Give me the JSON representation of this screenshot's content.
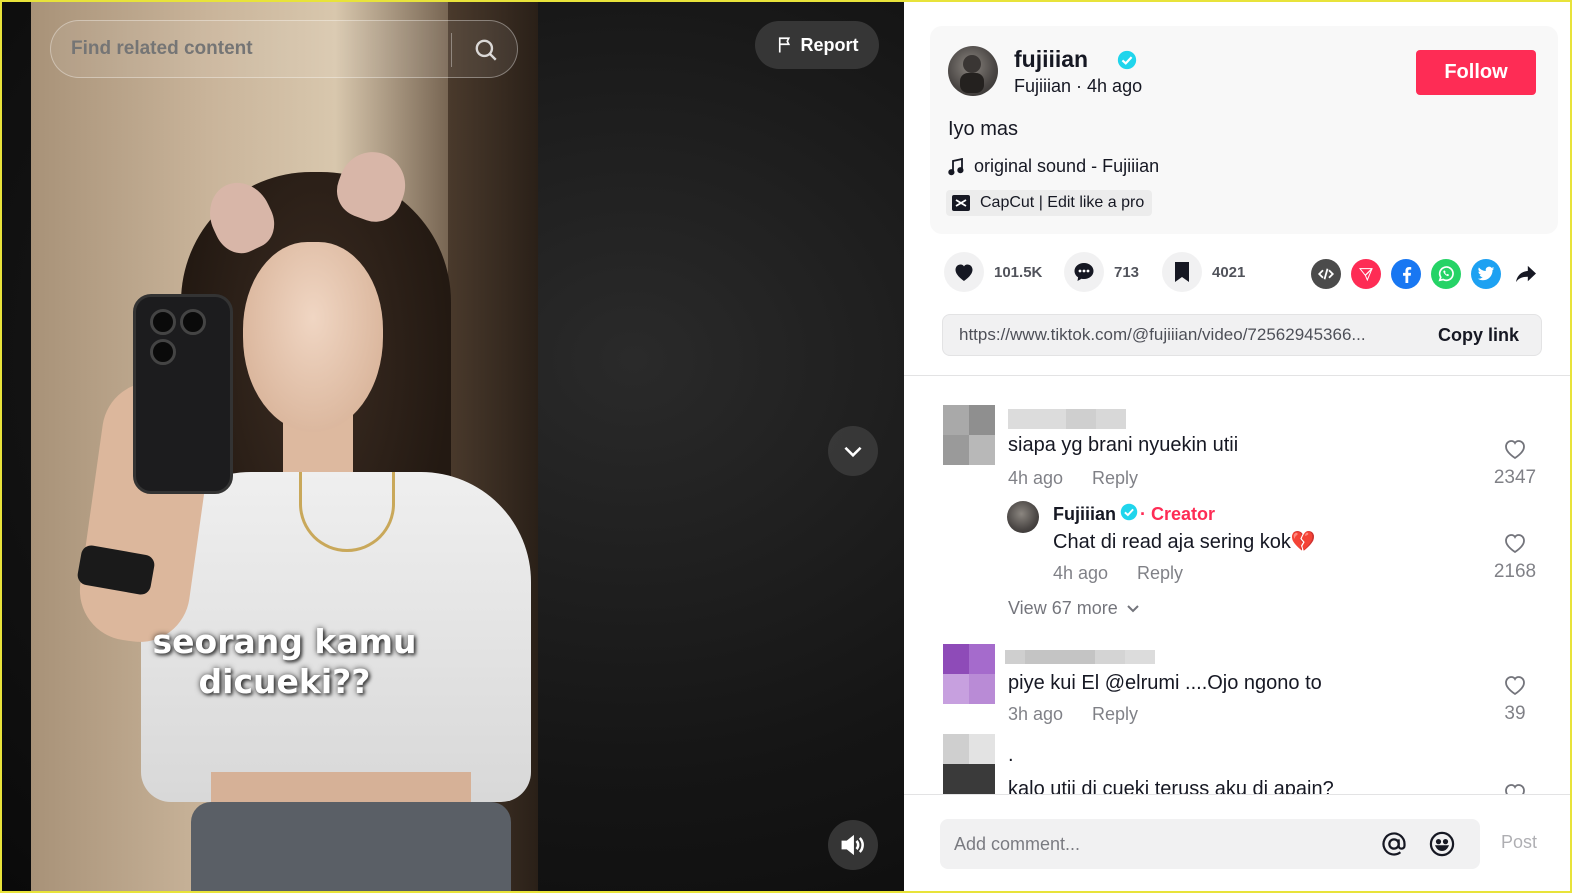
{
  "search": {
    "placeholder": "Find related content"
  },
  "video": {
    "caption": "seorang kamu\ndicueki??",
    "report_label": "Report"
  },
  "author": {
    "username": "fujiiian",
    "nickname": "Fujiiian",
    "posted": "4h ago",
    "separator": " · ",
    "follow_label": "Follow"
  },
  "post": {
    "description": "Iyo mas",
    "music": "original sound - Fujiiian",
    "capcut": "CapCut | Edit like a pro"
  },
  "stats": {
    "likes": "101.5K",
    "comments": "713",
    "saves": "4021"
  },
  "share_icons": [
    "embed-icon",
    "send-to-friends-icon",
    "facebook-icon",
    "whatsapp-icon",
    "twitter-icon",
    "share-arrow-icon"
  ],
  "link": {
    "url": "https://www.tiktok.com/@fujiiian/video/72562945366...",
    "copy_label": "Copy link"
  },
  "comments": [
    {
      "text": "siapa yg brani nyuekin utii",
      "time": "4h ago",
      "reply_label": "Reply",
      "likes": "2347",
      "replies": [
        {
          "name": "Fujiiian",
          "badge": "· Creator",
          "text": "Chat di read aja sering kok💔",
          "time": "4h ago",
          "reply_label": "Reply",
          "likes": "2168"
        }
      ],
      "view_more": "View 67 more"
    },
    {
      "text": "piye kui El @elrumi ....Ojo ngono to",
      "time": "3h ago",
      "reply_label": "Reply",
      "likes": "39"
    },
    {
      "text": "kalo utii di cueki teruss aku di apain?",
      "line1": "."
    }
  ],
  "composer": {
    "placeholder": "Add comment...",
    "post_label": "Post"
  },
  "colors": {
    "accent": "#fe2c55",
    "verified": "#20d5ec",
    "creator": "#fe2c55"
  }
}
